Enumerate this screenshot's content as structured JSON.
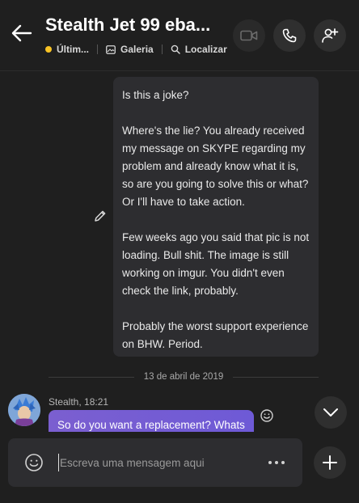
{
  "header": {
    "title": "Stealth Jet 99 eba...",
    "status_label": "Últim...",
    "gallery_label": "Galeria",
    "find_label": "Localizar"
  },
  "messages": {
    "outgoing": {
      "paragraphs": [
        "Is this a joke?",
        "Where's the lie? You already received my message on SKYPE regarding my problem and already know what it is, so are you going to solve this or what? Or I'll have to take action.",
        "Few weeks ago you said that pic is not loading. Bull shit. The image is still working on imgur. You didn't even check the link, probably.",
        "Probably the worst support experience on BHW. Period."
      ]
    },
    "date_divider": "13 de abril de 2019",
    "incoming": {
      "sender_line": "Stealth, 18:21",
      "text": "So do you want a replacement? Whats"
    }
  },
  "composer": {
    "placeholder": "Escreva uma mensagem aqui"
  },
  "colors": {
    "background": "#1f1f1f",
    "bubble_out": "#2d2d30",
    "bubble_in": "#7b5fd0",
    "status_away": "#f8c325"
  },
  "icons": {
    "back": "arrow-left-icon",
    "status": "away-status-icon",
    "gallery": "gallery-icon",
    "find": "search-icon",
    "video": "video-call-icon",
    "call": "phone-icon",
    "add_people": "add-person-icon",
    "edit": "pencil-icon",
    "react": "smiley-icon",
    "scroll": "chevron-down-icon",
    "emoji": "emoji-icon",
    "more": "more-dots-icon",
    "add": "plus-icon"
  }
}
